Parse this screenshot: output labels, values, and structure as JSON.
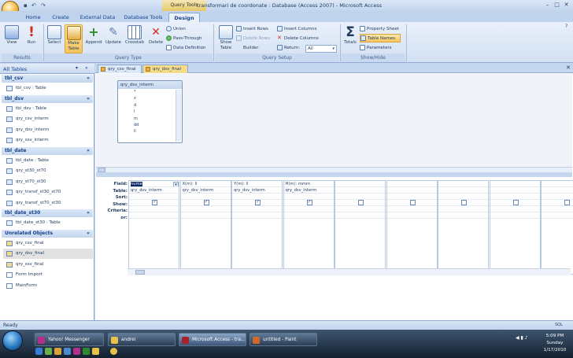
{
  "window": {
    "context_tab": "Query Tools",
    "title": "transformari de coordonate : Database (Access 2007) - Microsoft Access",
    "controls": [
      "–",
      "□",
      "✕"
    ]
  },
  "ribbon_tabs": [
    "Home",
    "Create",
    "External Data",
    "Database Tools",
    "Design"
  ],
  "active_tab": "Design",
  "ribbon": {
    "results": {
      "label": "Results",
      "view": "View",
      "run": "Run"
    },
    "query_type": {
      "label": "Query Type",
      "select": "Select",
      "make_table": "Make Table",
      "append": "Append",
      "update": "Update",
      "crosstab": "Crosstab",
      "delete": "Delete",
      "union": "Union",
      "pass_through": "Pass-Through",
      "data_definition": "Data Definition"
    },
    "query_setup": {
      "label": "Query Setup",
      "show_table": "Show Table",
      "insert_rows": "Insert Rows",
      "delete_rows": "Delete Rows",
      "builder": "Builder",
      "insert_columns": "Insert Columns",
      "delete_columns": "Delete Columns",
      "return_label": "Return:",
      "return_value": "All"
    },
    "show_hide": {
      "label": "Show/Hide",
      "totals": "Totals",
      "property_sheet": "Property Sheet",
      "table_names": "Table Names",
      "parameters": "Parameters"
    }
  },
  "nav": {
    "header": "All Tables",
    "groups": [
      {
        "name": "tbl_csv",
        "items": [
          {
            "label": "tbl_csv : Table",
            "icon": "table-icon"
          }
        ]
      },
      {
        "name": "tbl_dsv",
        "items": [
          {
            "label": "tbl_dsv : Table",
            "icon": "table-icon"
          },
          {
            "label": "qry_csv_interm",
            "icon": "query-icon"
          },
          {
            "label": "qry_dsv_interm",
            "icon": "query-icon"
          },
          {
            "label": "qry_ssv_interm",
            "icon": "query-icon"
          }
        ]
      },
      {
        "name": "tbl_date",
        "items": [
          {
            "label": "tbl_date : Table",
            "icon": "table-icon"
          },
          {
            "label": "qry_st30_st70",
            "icon": "query-icon"
          },
          {
            "label": "qry_st70_st30",
            "icon": "query-icon"
          },
          {
            "label": "qry_transf_st30_st70",
            "icon": "query-icon"
          },
          {
            "label": "qry_transf_st70_st30",
            "icon": "query-icon"
          }
        ]
      },
      {
        "name": "tbl_date_st30",
        "items": [
          {
            "label": "tbl_date_st30 : Table",
            "icon": "table-icon"
          }
        ]
      },
      {
        "name": "Unrelated Objects",
        "items": [
          {
            "label": "qry_csv_final",
            "icon": "maketable-query-icon"
          },
          {
            "label": "qry_dsv_final",
            "icon": "maketable-query-icon"
          },
          {
            "label": "qry_ssv_final",
            "icon": "maketable-query-icon"
          },
          {
            "label": "Form Import",
            "icon": "form-icon"
          },
          {
            "label": "MainForm",
            "icon": "form-icon"
          }
        ]
      }
    ]
  },
  "doc_tabs": [
    "qry_csv_final",
    "qry_dsv_final"
  ],
  "table_box": {
    "title": "qry_dsv_interm",
    "fields": [
      "*",
      "z",
      "d",
      "l",
      "m",
      "dd",
      "ll"
    ]
  },
  "grid": {
    "row_labels": [
      "Field:",
      "Table:",
      "Sort:",
      "Show:",
      "Criteria:",
      "or:"
    ],
    "columns": [
      {
        "field": "nume",
        "table": "qry_dsv_interm",
        "show": true
      },
      {
        "field": "X(m): ll",
        "table": "qry_dsv_interm",
        "show": true
      },
      {
        "field": "Y(m): ll",
        "table": "qry_dsv_interm",
        "show": true
      },
      {
        "field": "H(m): mmm",
        "table": "qry_dsv_interm",
        "show": true
      },
      {
        "field": "",
        "table": "",
        "show": false
      },
      {
        "field": "",
        "table": "",
        "show": false
      },
      {
        "field": "",
        "table": "",
        "show": false
      },
      {
        "field": "",
        "table": "",
        "show": false
      },
      {
        "field": "",
        "table": "",
        "show": false
      }
    ]
  },
  "status": {
    "text": "Ready",
    "right": "SQL"
  },
  "taskbar": {
    "buttons": [
      {
        "label": "Yahoo! Messenger",
        "color": "#b0308a"
      },
      {
        "label": "andrei",
        "color": "#e8c14a"
      },
      {
        "label": "Microsoft Access - tra...",
        "color": "#a8222b"
      },
      {
        "label": "untitled - Paint",
        "color": "#d06b2a"
      }
    ],
    "active": "Microsoft Access - tra...",
    "clock": {
      "time": "5:09 PM",
      "day": "Sunday",
      "date": "1/17/2010"
    }
  }
}
